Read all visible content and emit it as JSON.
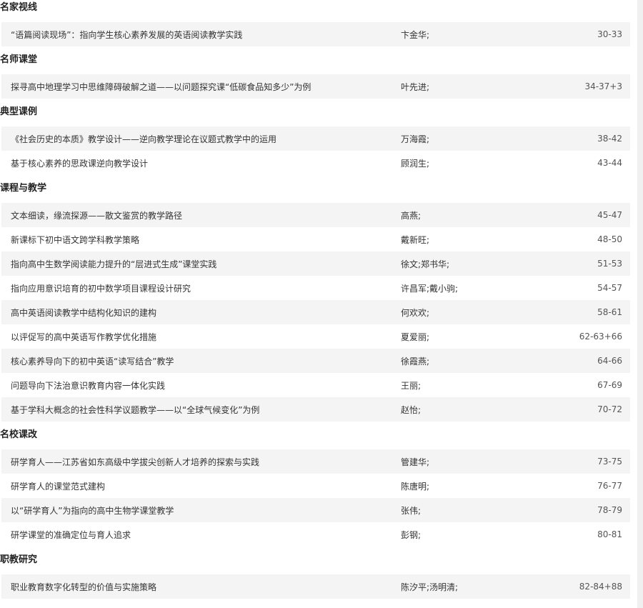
{
  "sections": [
    {
      "name": "名家视线",
      "items": [
        {
          "title": "“语篇阅读现场”：指向学生核心素养发展的英语阅读教学实践",
          "author": "卞金华;",
          "pages": "30-33"
        }
      ]
    },
    {
      "name": "名师课堂",
      "items": [
        {
          "title": "探寻高中地理学习中思维障碍破解之道——以问题探究课“低碳食品知多少”为例",
          "author": "叶先进;",
          "pages": "34-37+3"
        }
      ]
    },
    {
      "name": "典型课例",
      "items": [
        {
          "title": "《社会历史的本质》教学设计——逆向教学理论在议题式教学中的运用",
          "author": "万海霞;",
          "pages": "38-42"
        },
        {
          "title": "基于核心素养的思政课逆向教学设计",
          "author": "顾润生;",
          "pages": "43-44"
        }
      ]
    },
    {
      "name": "课程与教学",
      "items": [
        {
          "title": "文本细读，缘流探源——散文鉴赏的教学路径",
          "author": "高燕;",
          "pages": "45-47"
        },
        {
          "title": "新课标下初中语文跨学科教学策略",
          "author": "戴新旺;",
          "pages": "48-50"
        },
        {
          "title": "指向高中生数学阅读能力提升的“层进式生成”课堂实践",
          "author": "徐文;郑书华;",
          "pages": "51-53"
        },
        {
          "title": "指向应用意识培育的初中数学项目课程设计研究",
          "author": "许昌军;戴小驹;",
          "pages": "54-57"
        },
        {
          "title": "高中英语阅读教学中结构化知识的建构",
          "author": "何欢欢;",
          "pages": "58-61"
        },
        {
          "title": "以评促写的高中英语写作教学优化措施",
          "author": "夏爱丽;",
          "pages": "62-63+66"
        },
        {
          "title": "核心素养导向下的初中英语“读写结合”教学",
          "author": "徐霞燕;",
          "pages": "64-66"
        },
        {
          "title": "问题导向下法治意识教育内容一体化实践",
          "author": "王丽;",
          "pages": "67-69"
        },
        {
          "title": "基于学科大概念的社会性科学议题教学——以“全球气候变化”为例",
          "author": "赵怡;",
          "pages": "70-72"
        }
      ]
    },
    {
      "name": "名校课改",
      "items": [
        {
          "title": "研学育人——江苏省如东高级中学拔尖创新人才培养的探索与实践",
          "author": "管建华;",
          "pages": "73-75"
        },
        {
          "title": "研学育人的课堂范式建构",
          "author": "陈唐明;",
          "pages": "76-77"
        },
        {
          "title": "以“研学育人”为指向的高中生物学课堂教学",
          "author": "张伟;",
          "pages": "78-79"
        },
        {
          "title": "研学课堂的准确定位与育人追求",
          "author": "彭钢;",
          "pages": "80-81"
        }
      ]
    },
    {
      "name": "职教研究",
      "items": [
        {
          "title": "职业教育数字化转型的价值与实施策略",
          "author": "陈汐平;汤明清;",
          "pages": "82-84+88"
        }
      ]
    }
  ]
}
